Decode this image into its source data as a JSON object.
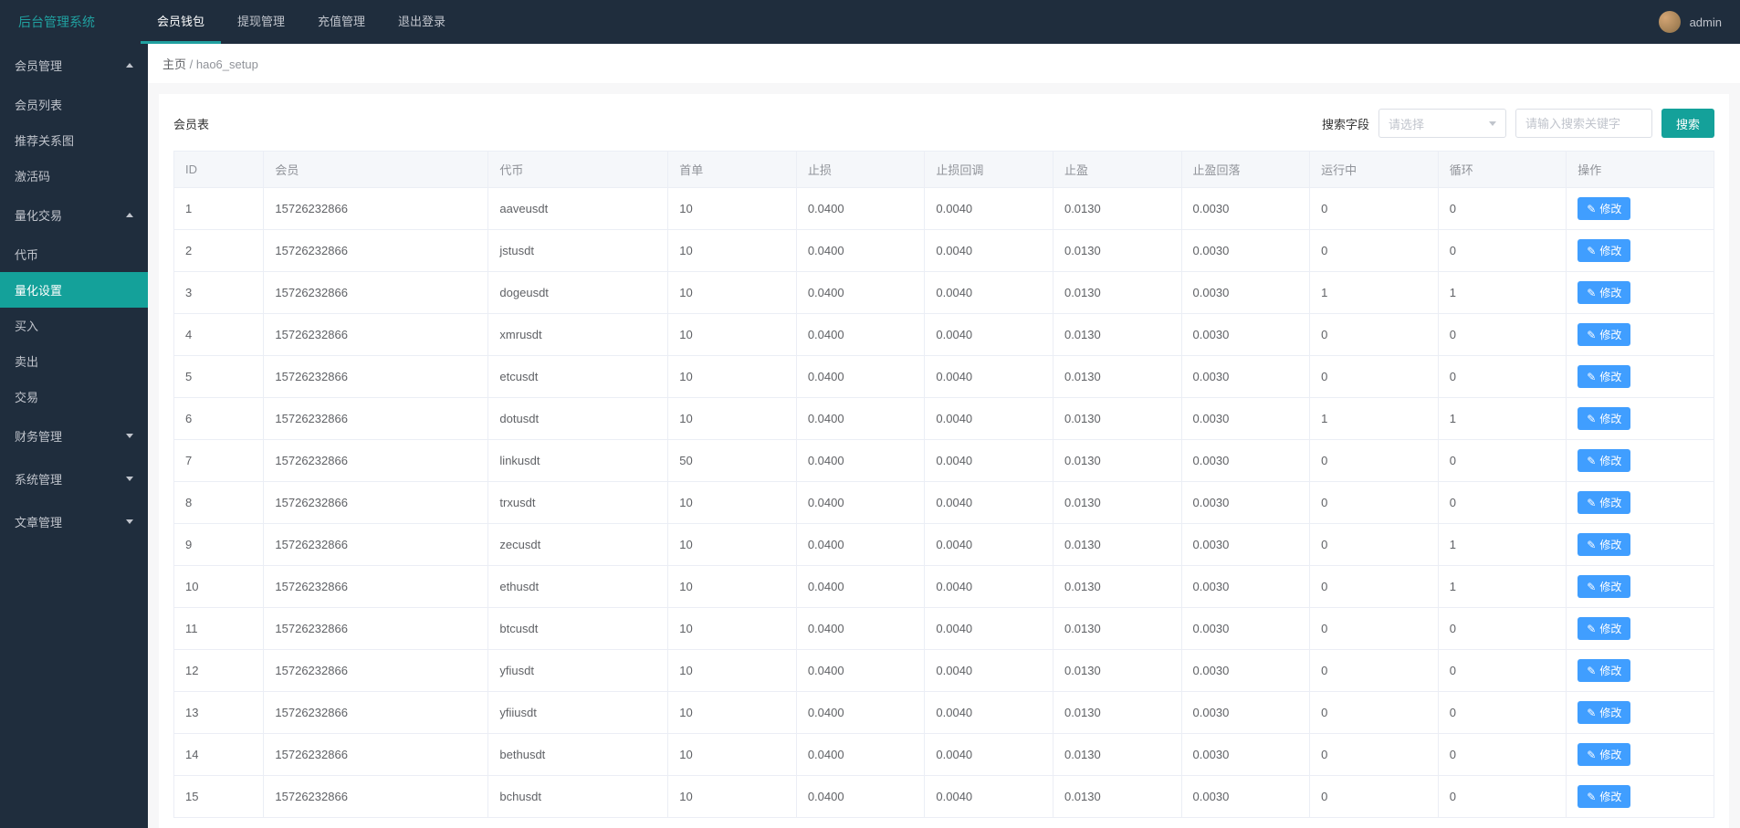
{
  "brand": "后台管理系统",
  "topnav": [
    {
      "label": "会员钱包",
      "active": true
    },
    {
      "label": "提现管理",
      "active": false
    },
    {
      "label": "充值管理",
      "active": false
    },
    {
      "label": "退出登录",
      "active": false
    }
  ],
  "user": {
    "name": "admin"
  },
  "sidebar": [
    {
      "title": "会员管理",
      "expanded": true,
      "items": [
        {
          "label": "会员列表"
        },
        {
          "label": "推荐关系图"
        },
        {
          "label": "激活码"
        }
      ]
    },
    {
      "title": "量化交易",
      "expanded": true,
      "items": [
        {
          "label": "代币"
        },
        {
          "label": "量化设置",
          "active": true
        },
        {
          "label": "买入"
        },
        {
          "label": "卖出"
        },
        {
          "label": "交易"
        }
      ]
    },
    {
      "title": "财务管理",
      "expanded": false,
      "items": []
    },
    {
      "title": "系统管理",
      "expanded": false,
      "items": []
    },
    {
      "title": "文章管理",
      "expanded": false,
      "items": []
    }
  ],
  "breadcrumb": {
    "home": "主页",
    "sep": " / ",
    "current": "hao6_setup"
  },
  "panel": {
    "title": "会员表"
  },
  "search": {
    "field_label": "搜索字段",
    "select_placeholder": "请选择",
    "input_placeholder": "请输入搜索关键字",
    "button": "搜索"
  },
  "columns": [
    "ID",
    "会员",
    "代币",
    "首单",
    "止损",
    "止损回调",
    "止盈",
    "止盈回落",
    "运行中",
    "循环",
    "操作"
  ],
  "edit_label": "修改",
  "rows": [
    {
      "id": "1",
      "member": "15726232866",
      "token": "aaveusdt",
      "first": "10",
      "stop": "0.0400",
      "stop_cb": "0.0040",
      "profit": "0.0130",
      "profit_fb": "0.0030",
      "running": "0",
      "loop": "0"
    },
    {
      "id": "2",
      "member": "15726232866",
      "token": "jstusdt",
      "first": "10",
      "stop": "0.0400",
      "stop_cb": "0.0040",
      "profit": "0.0130",
      "profit_fb": "0.0030",
      "running": "0",
      "loop": "0"
    },
    {
      "id": "3",
      "member": "15726232866",
      "token": "dogeusdt",
      "first": "10",
      "stop": "0.0400",
      "stop_cb": "0.0040",
      "profit": "0.0130",
      "profit_fb": "0.0030",
      "running": "1",
      "loop": "1"
    },
    {
      "id": "4",
      "member": "15726232866",
      "token": "xmrusdt",
      "first": "10",
      "stop": "0.0400",
      "stop_cb": "0.0040",
      "profit": "0.0130",
      "profit_fb": "0.0030",
      "running": "0",
      "loop": "0"
    },
    {
      "id": "5",
      "member": "15726232866",
      "token": "etcusdt",
      "first": "10",
      "stop": "0.0400",
      "stop_cb": "0.0040",
      "profit": "0.0130",
      "profit_fb": "0.0030",
      "running": "0",
      "loop": "0"
    },
    {
      "id": "6",
      "member": "15726232866",
      "token": "dotusdt",
      "first": "10",
      "stop": "0.0400",
      "stop_cb": "0.0040",
      "profit": "0.0130",
      "profit_fb": "0.0030",
      "running": "1",
      "loop": "1"
    },
    {
      "id": "7",
      "member": "15726232866",
      "token": "linkusdt",
      "first": "50",
      "stop": "0.0400",
      "stop_cb": "0.0040",
      "profit": "0.0130",
      "profit_fb": "0.0030",
      "running": "0",
      "loop": "0"
    },
    {
      "id": "8",
      "member": "15726232866",
      "token": "trxusdt",
      "first": "10",
      "stop": "0.0400",
      "stop_cb": "0.0040",
      "profit": "0.0130",
      "profit_fb": "0.0030",
      "running": "0",
      "loop": "0"
    },
    {
      "id": "9",
      "member": "15726232866",
      "token": "zecusdt",
      "first": "10",
      "stop": "0.0400",
      "stop_cb": "0.0040",
      "profit": "0.0130",
      "profit_fb": "0.0030",
      "running": "0",
      "loop": "1"
    },
    {
      "id": "10",
      "member": "15726232866",
      "token": "ethusdt",
      "first": "10",
      "stop": "0.0400",
      "stop_cb": "0.0040",
      "profit": "0.0130",
      "profit_fb": "0.0030",
      "running": "0",
      "loop": "1"
    },
    {
      "id": "11",
      "member": "15726232866",
      "token": "btcusdt",
      "first": "10",
      "stop": "0.0400",
      "stop_cb": "0.0040",
      "profit": "0.0130",
      "profit_fb": "0.0030",
      "running": "0",
      "loop": "0"
    },
    {
      "id": "12",
      "member": "15726232866",
      "token": "yfiusdt",
      "first": "10",
      "stop": "0.0400",
      "stop_cb": "0.0040",
      "profit": "0.0130",
      "profit_fb": "0.0030",
      "running": "0",
      "loop": "0"
    },
    {
      "id": "13",
      "member": "15726232866",
      "token": "yfiiusdt",
      "first": "10",
      "stop": "0.0400",
      "stop_cb": "0.0040",
      "profit": "0.0130",
      "profit_fb": "0.0030",
      "running": "0",
      "loop": "0"
    },
    {
      "id": "14",
      "member": "15726232866",
      "token": "bethusdt",
      "first": "10",
      "stop": "0.0400",
      "stop_cb": "0.0040",
      "profit": "0.0130",
      "profit_fb": "0.0030",
      "running": "0",
      "loop": "0"
    },
    {
      "id": "15",
      "member": "15726232866",
      "token": "bchusdt",
      "first": "10",
      "stop": "0.0400",
      "stop_cb": "0.0040",
      "profit": "0.0130",
      "profit_fb": "0.0030",
      "running": "0",
      "loop": "0"
    }
  ]
}
